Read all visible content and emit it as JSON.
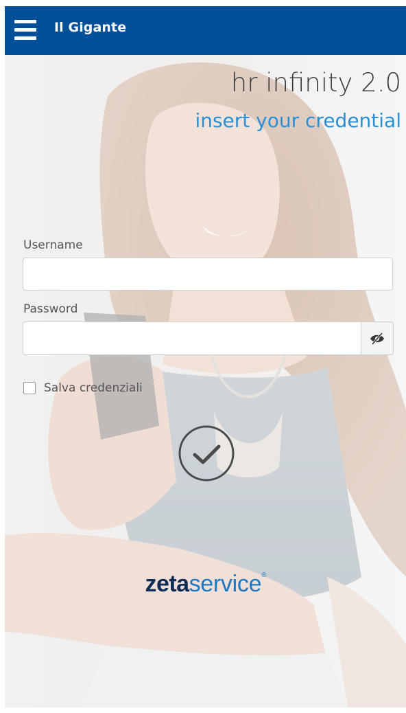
{
  "header": {
    "title": "Il Gigante",
    "menu_icon": "hamburger-menu-icon",
    "background_color": "#02509a"
  },
  "hero": {
    "title": "hr infinity 2.0",
    "subtitle": "insert your credential",
    "subtitle_color": "#2b8fd2"
  },
  "form": {
    "username_label": "Username",
    "username_value": "",
    "password_label": "Password",
    "password_value": "",
    "show_password_icon": "eye-slash-icon",
    "remember_label": "Salva credenziali",
    "remember_checked": false,
    "submit_icon": "check-circle-icon"
  },
  "footer": {
    "brand_bold": "zeta",
    "brand_light": "service",
    "brand_mark": "®"
  }
}
